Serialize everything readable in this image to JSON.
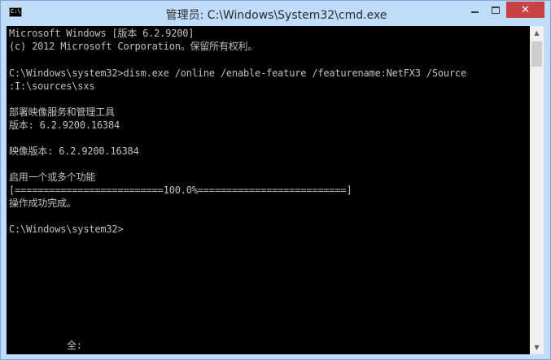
{
  "window": {
    "title": "管理员: C:\\Windows\\System32\\cmd.exe",
    "icon_label": "C:\\"
  },
  "controls": {
    "minimize": "minimize-icon",
    "maximize": "maximize-icon",
    "close": "close-icon",
    "close_glyph": "✕"
  },
  "console": {
    "lines": [
      "Microsoft Windows [版本 6.2.9200]",
      "(c) 2012 Microsoft Corporation。保留所有权利。",
      "",
      "C:\\Windows\\system32>dism.exe /online /enable-feature /featurename:NetFX3 /Source",
      ":I:\\sources\\sxs",
      "",
      "部署映像服务和管理工具",
      "版本: 6.2.9200.16384",
      "",
      "映像版本: 6.2.9200.16384",
      "",
      "启用一个或多个功能",
      "[==========================100.0%==========================]",
      "操作成功完成。",
      "",
      "C:\\Windows\\system32>"
    ],
    "ime_status": "全:"
  },
  "scrollbar": {
    "up_glyph": "▲",
    "down_glyph": "▼"
  },
  "colors": {
    "console_bg": "#000000",
    "console_text": "#c0c0c0",
    "frame": "#c1dbfb",
    "close_button": "#c74242"
  }
}
